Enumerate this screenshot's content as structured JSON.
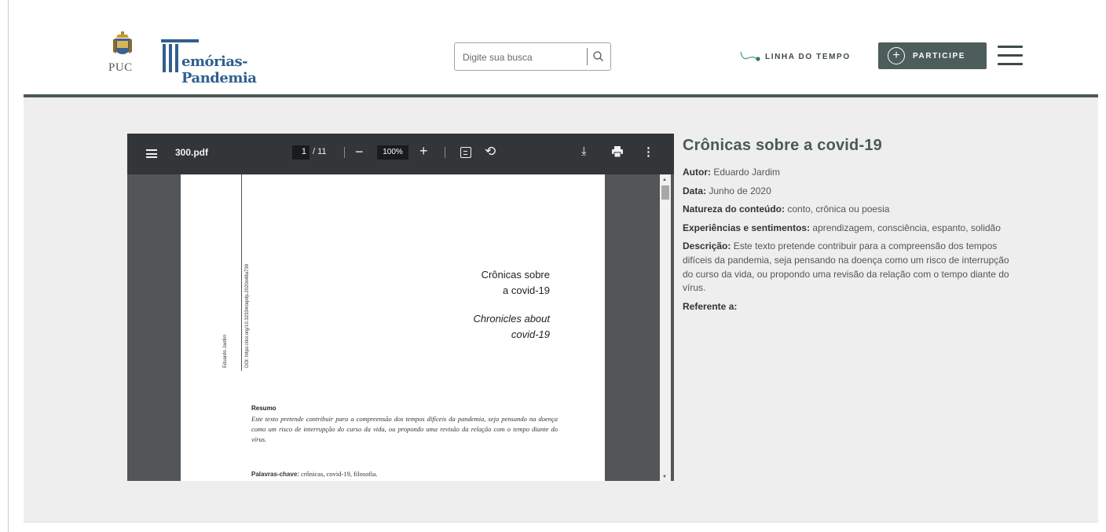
{
  "header": {
    "institution_logo_text": "PUC",
    "site_logo_text": "emórias-Pandemia",
    "search": {
      "placeholder": "Digite sua busca"
    },
    "timeline_label": "LINHA DO TEMPO",
    "participe_label": "PARTICIPE",
    "colors": {
      "accent": "#4d5e5a",
      "bar": "#4a5a57"
    }
  },
  "pdf_viewer": {
    "filename": "300.pdf",
    "current_page": "1",
    "total_pages": "/ 11",
    "zoom": "100%",
    "page": {
      "title_line1": "Crônicas sobre",
      "title_line2": "a covid-19",
      "subtitle_line1": "Chronicles about",
      "subtitle_line2": "covid-19",
      "abstract_heading": "Resumo",
      "abstract_text": "Este texto pretende contribuir para a compreensão dos tempos difíceis da pandemia, seja pensando na doença como um risco de interrupção do curso da vida, ou propondo uma revisão da relação com o tempo diante do vírus.",
      "keywords_label": "Palavras-chave:",
      "keywords_text": "crônicas, covid-19, filosofia."
    }
  },
  "info": {
    "title": "Crônicas sobre a covid-19",
    "author_label": "Autor:",
    "author_value": "Eduardo Jardim",
    "date_label": "Data:",
    "date_value": "Junho de 2020",
    "nature_label": "Natureza do conteúdo:",
    "nature_value": "conto, crônica ou poesia",
    "experiences_label": "Experiências e sentimentos:",
    "experiences_value": "aprendizagem, consciência, espanto, solidão",
    "description_label": "Descrição:",
    "description_value": "Este texto pretende contribuir para a compreensão dos tempos difíceis da pandemia, seja pensando na doença como um risco de interrupção do curso da vida, ou propondo uma revisão da relação com o tempo diante do vírus.",
    "referent_label": "Referente a:"
  }
}
